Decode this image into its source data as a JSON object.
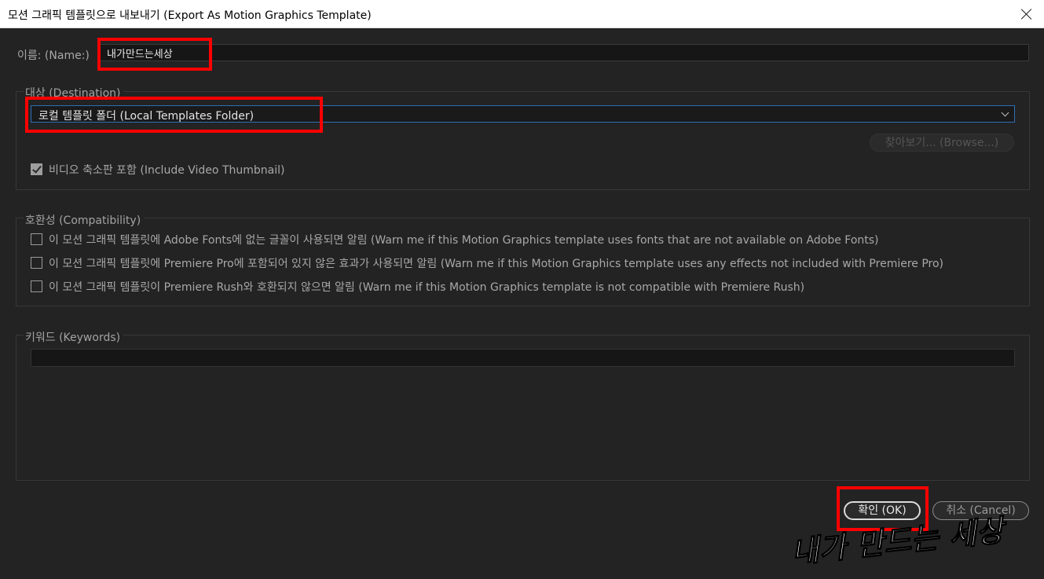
{
  "window": {
    "title": "모션 그래픽 템플릿으로 내보내기 (Export As Motion Graphics Template)"
  },
  "name_field": {
    "label": "이름: (Name:)",
    "value": "내가만드는세상"
  },
  "destination": {
    "legend": "대상 (Destination)",
    "selected": "로컬 템플릿 폴더 (Local Templates Folder)",
    "browse_label": "찾아보기... (Browse...)",
    "include_thumbnail": {
      "label": "비디오 축소판 포함 (Include Video Thumbnail)",
      "checked": true
    }
  },
  "compatibility": {
    "legend": "호환성 (Compatibility)",
    "options": [
      {
        "label": "이 모션 그래픽 템플릿에 Adobe Fonts에 없는 글꼴이 사용되면 알림 (Warn me if this Motion Graphics template uses fonts that are not available on Adobe Fonts)",
        "checked": false
      },
      {
        "label": "이 모션 그래픽 템플릿에 Premiere Pro에 포함되어 있지 않은 효과가 사용되면 알림 (Warn me if this Motion Graphics template uses any effects not included with Premiere Pro)",
        "checked": false
      },
      {
        "label": "이 모션 그래픽 템플릿이 Premiere Rush와 호환되지 않으면 알림 (Warn me if this Motion Graphics template is not compatible with Premiere Rush)",
        "checked": false
      }
    ]
  },
  "keywords": {
    "legend": "키워드 (Keywords)",
    "value": ""
  },
  "buttons": {
    "ok": "확인 (OK)",
    "cancel": "취소 (Cancel)"
  },
  "watermark": "내가 만드는 세상",
  "colors": {
    "background": "#232323",
    "annotation": "#ff0000",
    "focus_border": "#2d6fb5"
  }
}
